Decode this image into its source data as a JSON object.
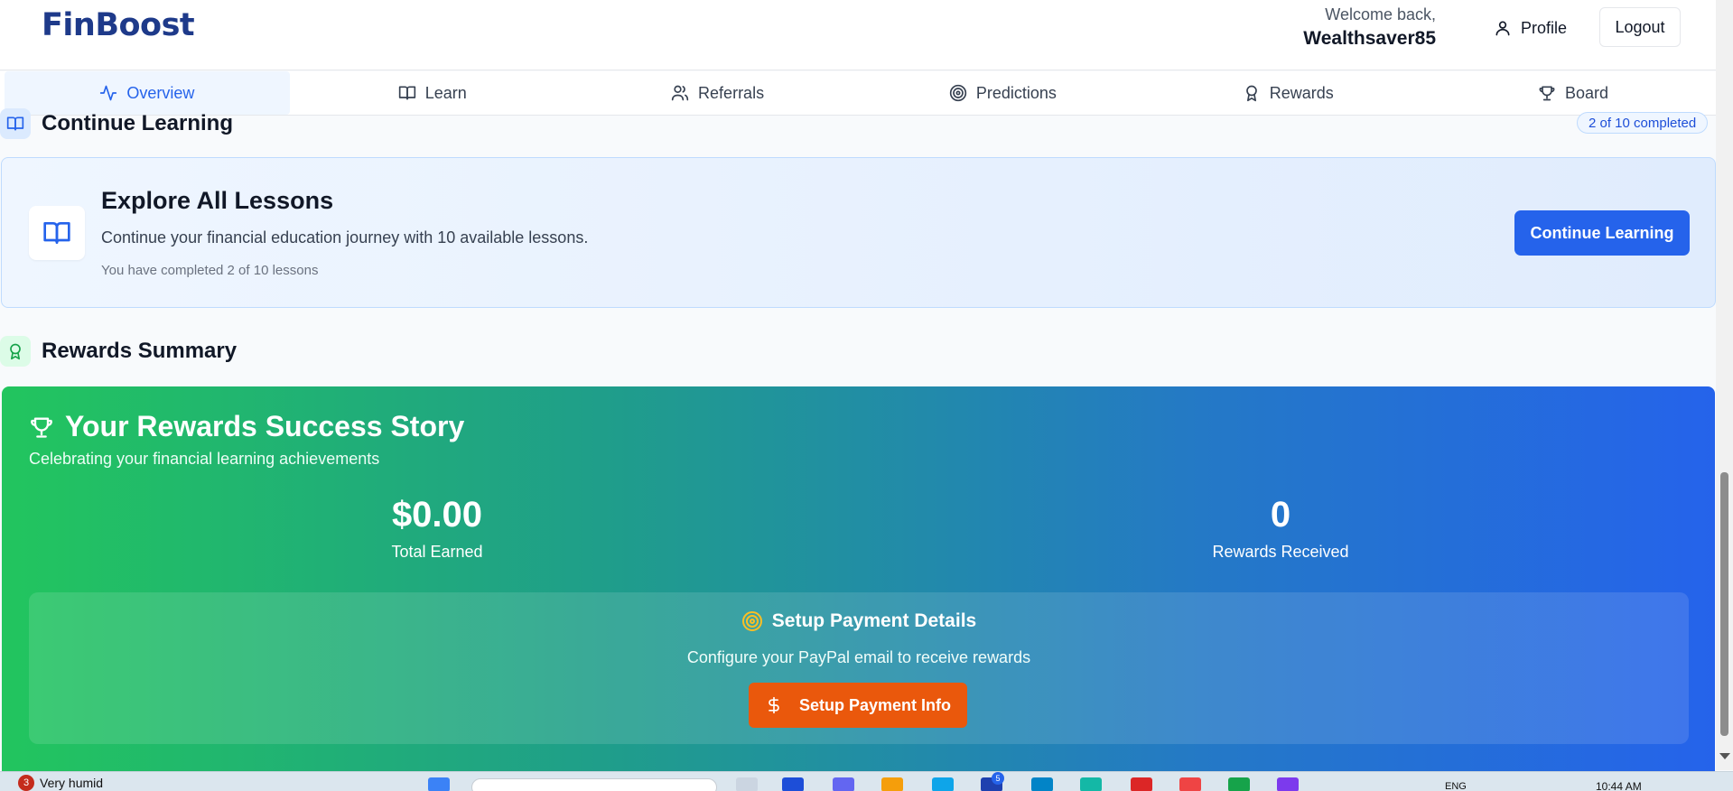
{
  "header": {
    "logo": "FinBoost",
    "welcome_line": "Welcome back,",
    "username": "Wealthsaver85",
    "profile_label": "Profile",
    "logout_label": "Logout"
  },
  "tabs": [
    {
      "label": "Overview",
      "icon": "activity-icon",
      "active": true
    },
    {
      "label": "Learn",
      "icon": "book-icon",
      "active": false
    },
    {
      "label": "Referrals",
      "icon": "users-icon",
      "active": false
    },
    {
      "label": "Predictions",
      "icon": "target-icon",
      "active": false
    },
    {
      "label": "Rewards",
      "icon": "award-icon",
      "active": false
    },
    {
      "label": "Board",
      "icon": "trophy-icon",
      "active": false
    }
  ],
  "continue_learning": {
    "section_title": "Continue Learning",
    "progress_badge": "2 of 10 completed",
    "card_title": "Explore All Lessons",
    "card_description": "Continue your financial education journey with 10 available lessons.",
    "card_progress": "You have completed 2 of 10 lessons",
    "button_label": "Continue Learning"
  },
  "rewards_summary": {
    "section_title": "Rewards Summary",
    "card_title": "Your Rewards Success Story",
    "card_subtitle": "Celebrating your financial learning achievements",
    "stats": [
      {
        "value": "$0.00",
        "label": "Total Earned"
      },
      {
        "value": "0",
        "label": "Rewards Received"
      }
    ],
    "payment": {
      "title": "Setup Payment Details",
      "description": "Configure your PayPal email to receive rewards",
      "button_label": "Setup Payment Info"
    }
  },
  "colors": {
    "primary": "#2563eb",
    "brand": "#1e3a8a",
    "reward_gradient_start": "#22c55e",
    "reward_gradient_end": "#2563eb",
    "payment_button": "#ea580c"
  },
  "taskbar": {
    "notification_count": "3",
    "weather": "Very humid",
    "app_badge": "5",
    "language": "ENG",
    "time": "10:44 AM"
  }
}
